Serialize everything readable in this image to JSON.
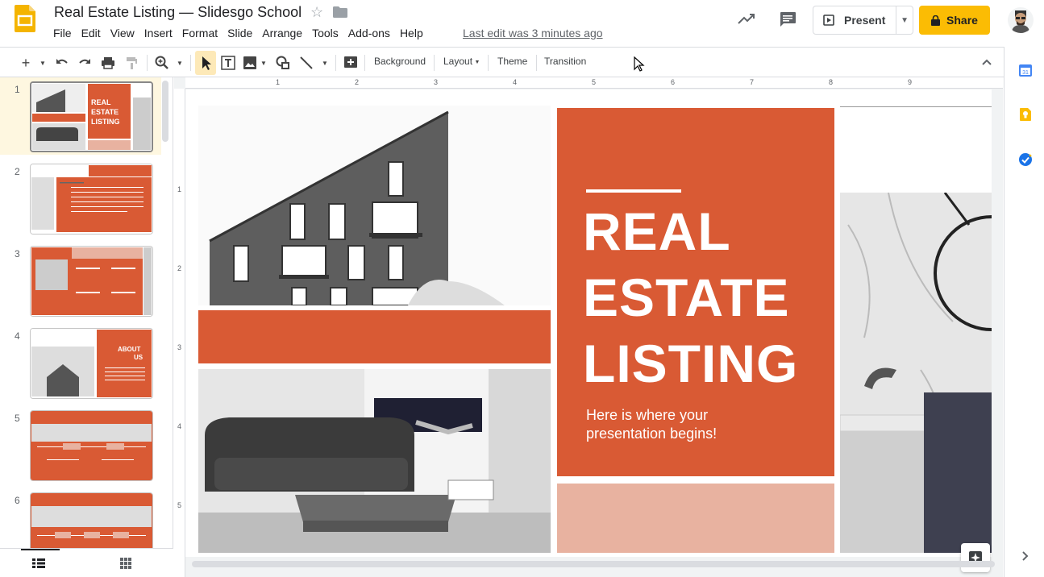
{
  "app": {
    "doc_title": "Real Estate Listing — Slidesgo School",
    "last_edit": "Last edit was 3 minutes ago"
  },
  "menu": [
    "File",
    "Edit",
    "View",
    "Insert",
    "Format",
    "Slide",
    "Arrange",
    "Tools",
    "Add-ons",
    "Help"
  ],
  "header": {
    "present_label": "Present",
    "share_label": "Share"
  },
  "toolbar": {
    "background_label": "Background",
    "layout_label": "Layout",
    "theme_label": "Theme",
    "transition_label": "Transition"
  },
  "rulers": {
    "horizontal": [
      "1",
      "2",
      "3",
      "4",
      "5",
      "6",
      "7",
      "8",
      "9"
    ],
    "vertical": [
      "1",
      "2",
      "3",
      "4",
      "5"
    ]
  },
  "filmstrip": {
    "slides": [
      {
        "number": "1",
        "title": "REAL ESTATE LISTING"
      },
      {
        "number": "2",
        "title": ""
      },
      {
        "number": "3",
        "title": ""
      },
      {
        "number": "4",
        "title": "ABOUT US"
      },
      {
        "number": "5",
        "title": ""
      },
      {
        "number": "6",
        "title": ""
      }
    ],
    "thumb5_years": [
      "2005",
      "2008"
    ],
    "thumb6_years": [
      "2010",
      "2015",
      "2019"
    ]
  },
  "slide": {
    "title_line1": "REAL",
    "title_line2": "ESTATE",
    "title_line3": "LISTING",
    "subtitle_line1": "Here is where your",
    "subtitle_line2": "presentation begins!"
  },
  "colors": {
    "accent": "#d95a34",
    "pink": "#e8b2a0",
    "share": "#fbbc04"
  }
}
